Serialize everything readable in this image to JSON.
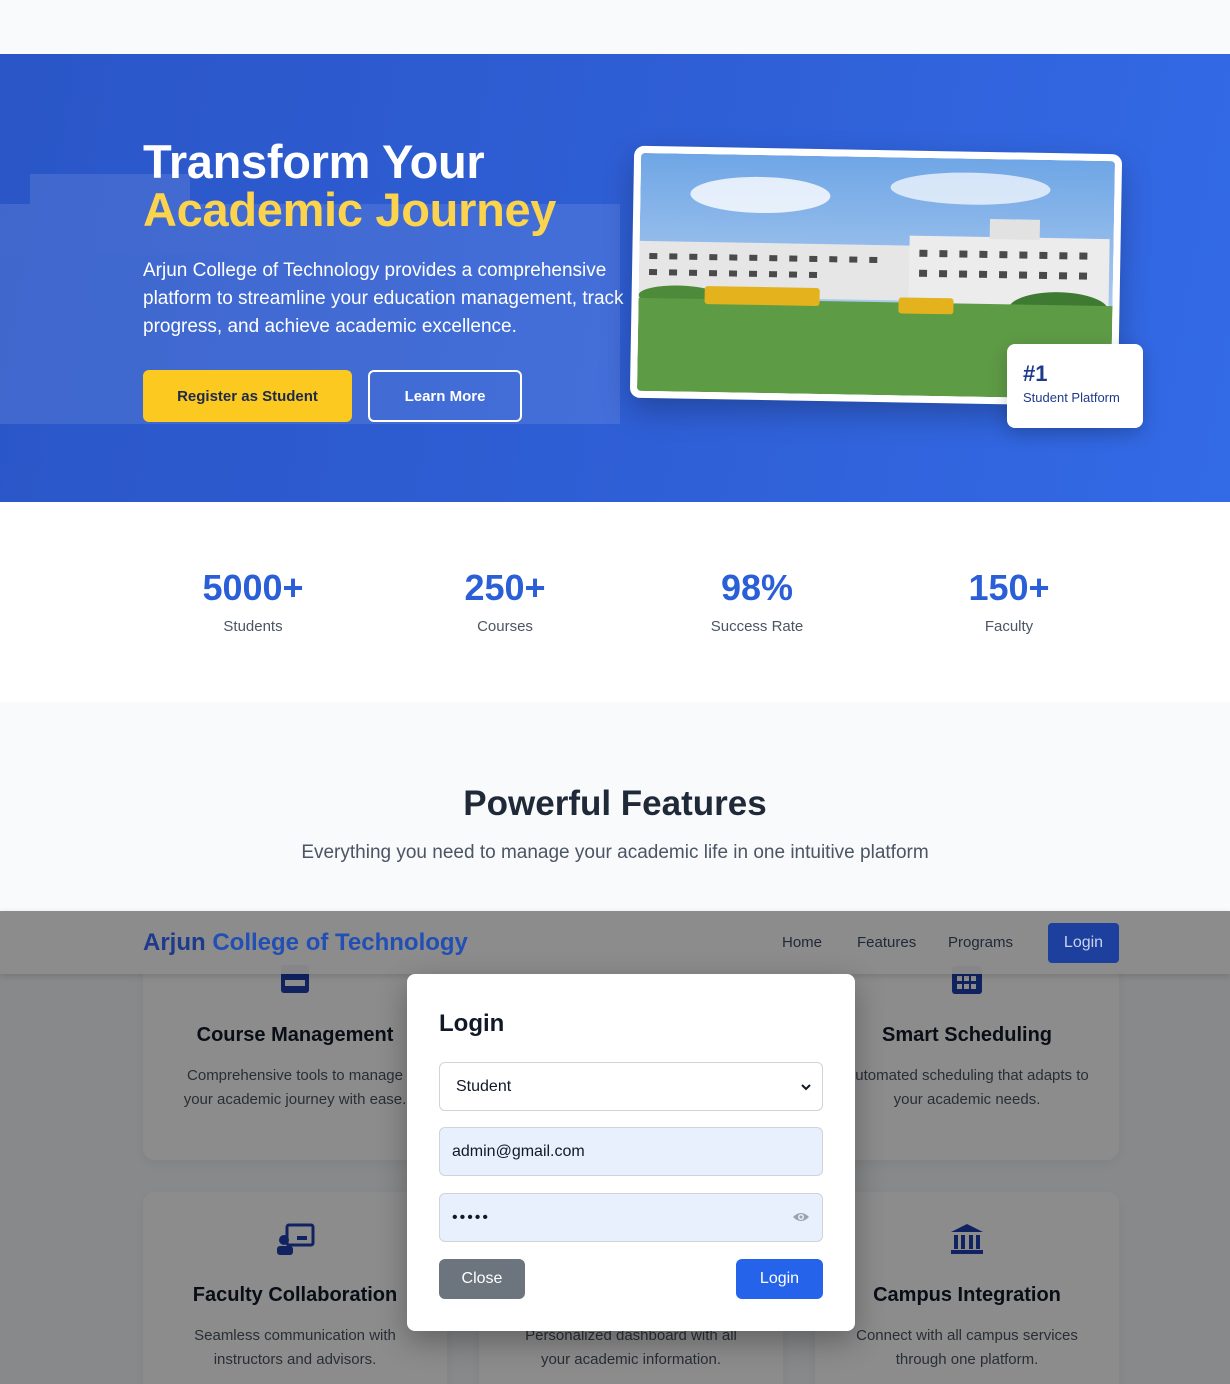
{
  "hero": {
    "title_line1": "Transform Your",
    "title_line2": "Academic Journey",
    "lead": "Arjun College of Technology provides a comprehensive platform to streamline your education management, track progress, and achieve academic excellence.",
    "register_label": "Register as Student",
    "learn_label": "Learn More",
    "badge_num": "#1",
    "badge_text": "Student Platform"
  },
  "stats": [
    {
      "value": "5000+",
      "label": "Students"
    },
    {
      "value": "250+",
      "label": "Courses"
    },
    {
      "value": "98%",
      "label": "Success Rate"
    },
    {
      "value": "150+",
      "label": "Faculty"
    }
  ],
  "features": {
    "title": "Powerful Features",
    "subtitle": "Everything you need to manage your academic life in one intuitive platform",
    "cards": [
      {
        "title": "Course Management",
        "desc": "Comprehensive tools to manage your academic journey with ease."
      },
      {
        "title": "Smart Scheduling",
        "desc": "Automated scheduling that adapts to your academic needs."
      },
      {
        "title": "Faculty Collaboration",
        "desc": "Seamless communication with instructors and advisors."
      },
      {
        "title": "",
        "desc": "Personalized dashboard with all your academic information."
      },
      {
        "title": "Campus Integration",
        "desc": "Connect with all campus services through one platform."
      }
    ]
  },
  "navbar": {
    "brand_part1": "Arjun",
    "brand_part2": "College of Technology",
    "links": [
      "Home",
      "Features",
      "Programs"
    ],
    "login_label": "Login"
  },
  "modal": {
    "title": "Login",
    "role_selected": "Student",
    "email_value": "admin@gmail.com",
    "password_mask": "•••••",
    "close_label": "Close",
    "login_label": "Login"
  },
  "colors": {
    "primary": "#2b5fd8",
    "accent": "#fbc91f",
    "dark_blue": "#1e3a8a"
  }
}
